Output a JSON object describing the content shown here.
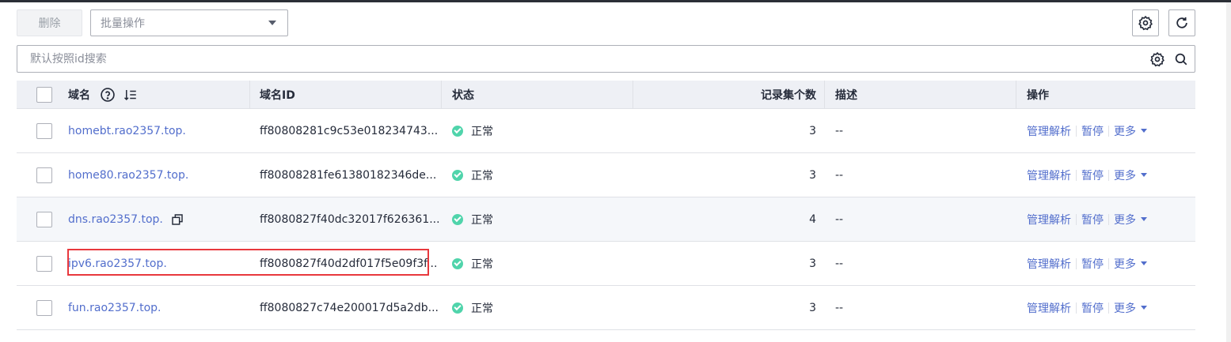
{
  "toolbar": {
    "delete_label": "删除",
    "batch_placeholder": "批量操作"
  },
  "search": {
    "placeholder": "默认按照id搜索"
  },
  "table": {
    "headers": {
      "domain": "域名",
      "domain_id": "域名ID",
      "status": "状态",
      "record_count": "记录集个数",
      "description": "描述",
      "actions": "操作"
    },
    "rows": [
      {
        "domain": "homebt.rao2357.top.",
        "id": "ff80808281c9c53e018234743...",
        "status": "正常",
        "count": "3",
        "desc": "--"
      },
      {
        "domain": "home80.rao2357.top.",
        "id": "ff80808281fe61380182346de...",
        "status": "正常",
        "count": "3",
        "desc": "--"
      },
      {
        "domain": "dns.rao2357.top.",
        "id": "ff8080827f40dc32017f626361...",
        "status": "正常",
        "count": "4",
        "desc": "--"
      },
      {
        "domain": "ipv6.rao2357.top.",
        "id": "ff8080827f40d2df017f5e09f3f...",
        "status": "正常",
        "count": "3",
        "desc": "--"
      },
      {
        "domain": "fun.rao2357.top.",
        "id": "ff8080827c74e200017d5a2db...",
        "status": "正常",
        "count": "3",
        "desc": "--"
      }
    ],
    "actions": {
      "manage": "管理解析",
      "pause": "暂停",
      "more": "更多"
    }
  },
  "colors": {
    "link": "#526ecc",
    "status_ok": "#50d4ab",
    "highlight": "#e8383d"
  }
}
